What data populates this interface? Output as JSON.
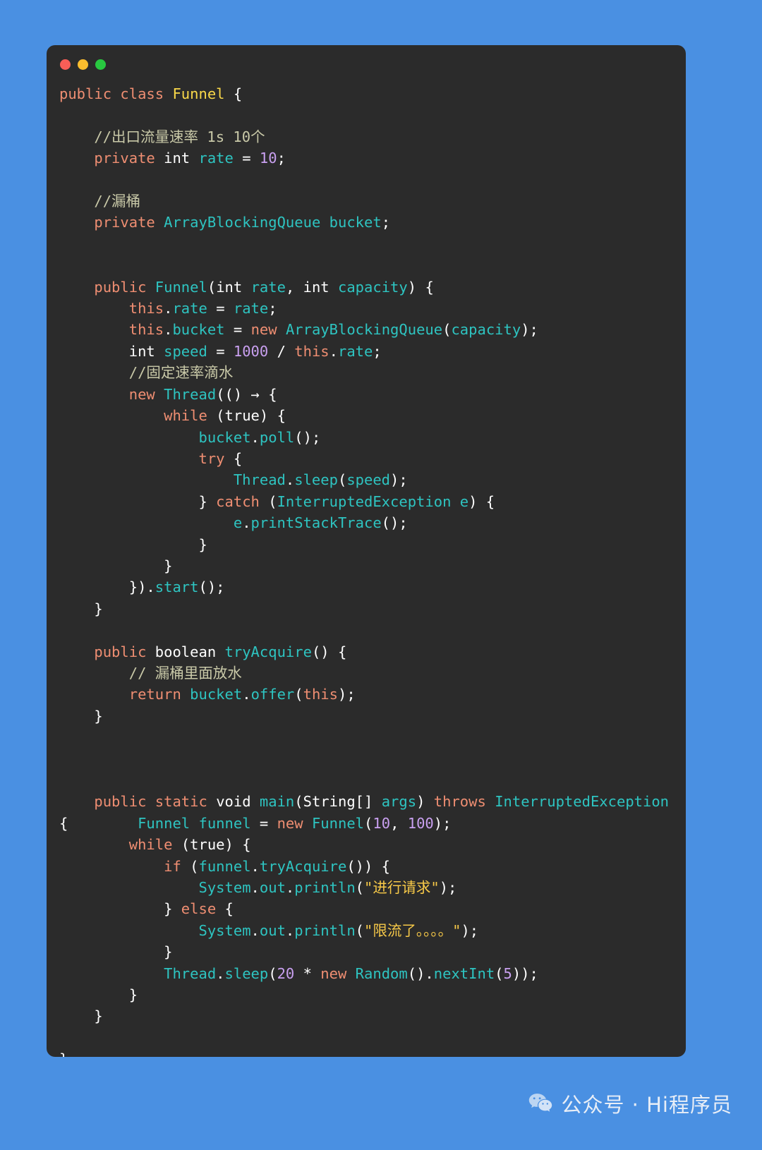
{
  "window": {
    "traffic_lights": [
      {
        "name": "close",
        "color": "#f95e57"
      },
      {
        "name": "minimize",
        "color": "#fbbd2e"
      },
      {
        "name": "zoom",
        "color": "#28c840"
      }
    ]
  },
  "theme": {
    "background": "#4a90e2",
    "panel": "#2b2b2b",
    "keyword": "#ef8e72",
    "type": "#2ec4c1",
    "classname": "#f9d849",
    "plain": "#ffffff",
    "number": "#c9a0f0",
    "comment": "#c9c9a8",
    "string": "#f7c948"
  },
  "code": {
    "language": "java",
    "class_name": "Funnel",
    "lines": [
      "public class Funnel {",
      "",
      "    //出口流量速率 1s 10个",
      "    private int rate = 10;",
      "",
      "    //漏桶",
      "    private ArrayBlockingQueue bucket;",
      "",
      "",
      "    public Funnel(int rate, int capacity) {",
      "        this.rate = rate;",
      "        this.bucket = new ArrayBlockingQueue(capacity);",
      "        int speed = 1000 / this.rate;",
      "        //固定速率滴水",
      "        new Thread(() -> {",
      "            while (true) {",
      "                bucket.poll();",
      "                try {",
      "                    Thread.sleep(speed);",
      "                } catch (InterruptedException e) {",
      "                    e.printStackTrace();",
      "                }",
      "            }",
      "        }).start();",
      "    }",
      "",
      "    public boolean tryAcquire() {",
      "        // 漏桶里面放水",
      "        return bucket.offer(this);",
      "    }",
      "",
      "",
      "",
      "    public static void main(String[] args) throws InterruptedException {",
      "        Funnel funnel = new Funnel(10, 100);",
      "        while (true) {",
      "            if (funnel.tryAcquire()) {",
      "                System.out.println(\"进行请求\");",
      "            } else {",
      "                System.out.println(\"限流了。。。。\");",
      "            }",
      "            Thread.sleep(20 * new Random().nextInt(5));",
      "        }",
      "    }",
      "",
      "}"
    ],
    "comments": [
      "//出口流量速率 1s 10个",
      "//漏桶",
      "//固定速率滴水",
      "// 漏桶里面放水"
    ],
    "strings": [
      "\"进行请求\"",
      "\"限流了。。。。\""
    ],
    "numbers": [
      "10",
      "1000",
      "20",
      "5",
      "100"
    ]
  },
  "footer": {
    "icon": "wechat-icon",
    "text": "公众号 · Hi程序员"
  }
}
